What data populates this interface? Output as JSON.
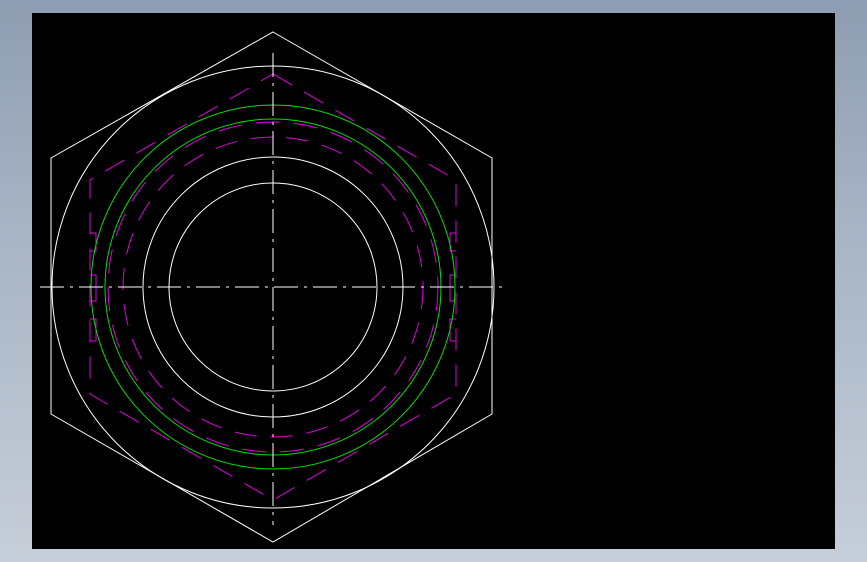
{
  "colors": {
    "background_outer": "#a9b6c6",
    "viewport_background": "#000000",
    "geometry_white": "#ffffff",
    "hidden_lines_magenta": "#e000e0",
    "thread_circles_green": "#00e000"
  },
  "drawing": {
    "subject": "hex-nut-top-view",
    "elements": [
      "hexagon-outline",
      "chamfer-circle",
      "thread-major-circles",
      "hidden-dashed-circles",
      "hidden-dashed-hexagon",
      "inner-bore-circles",
      "horizontal-centerline",
      "vertical-centerline"
    ]
  }
}
